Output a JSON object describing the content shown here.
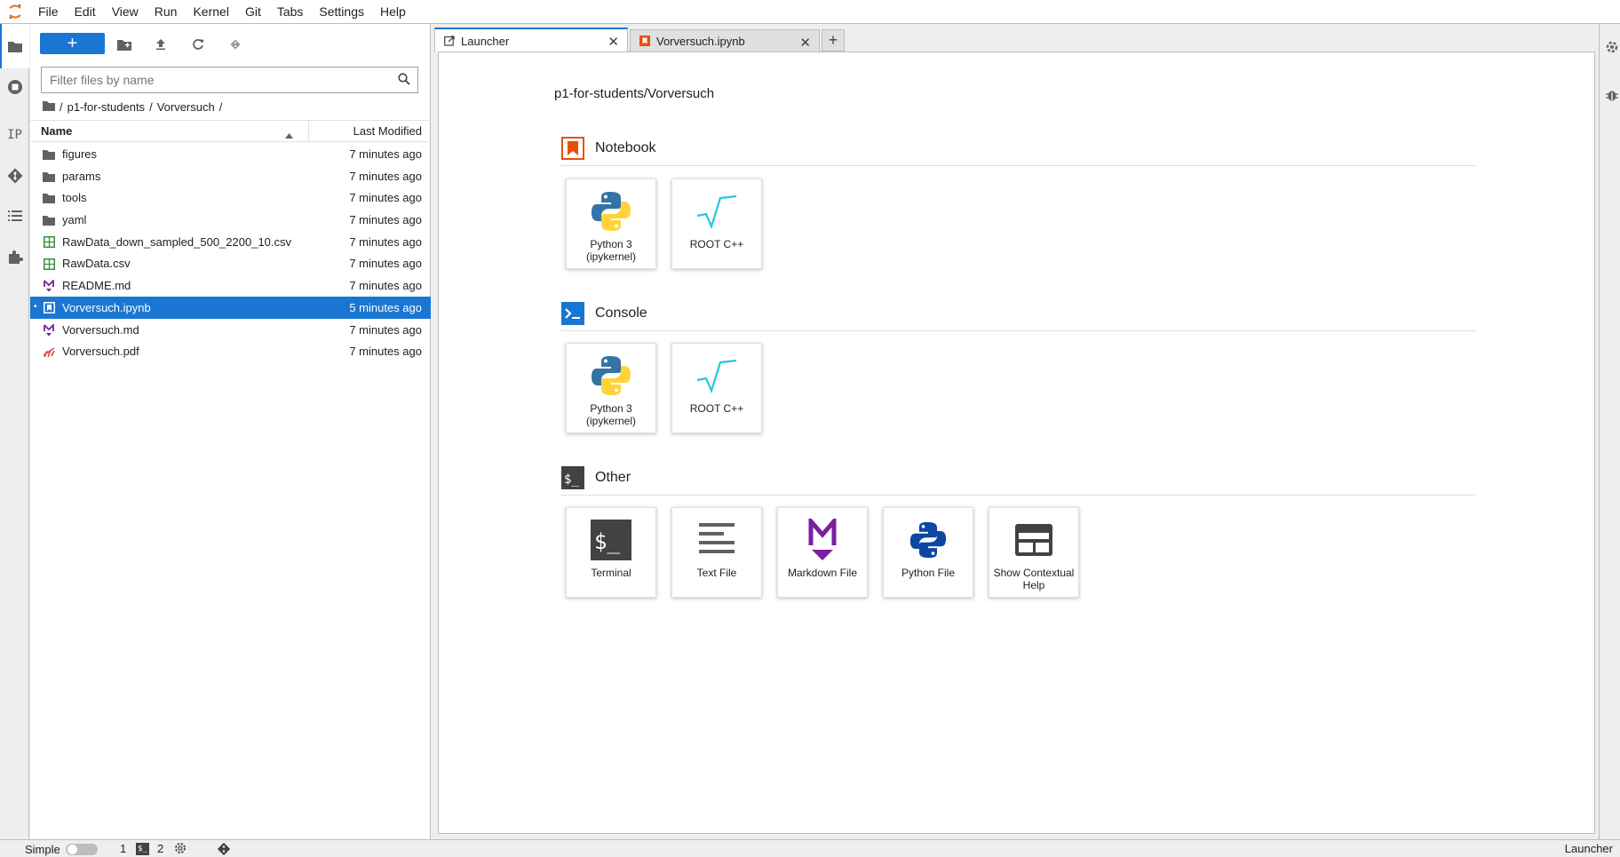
{
  "menubar": {
    "items": [
      "File",
      "Edit",
      "View",
      "Run",
      "Kernel",
      "Git",
      "Tabs",
      "Settings",
      "Help"
    ]
  },
  "leftbar": {
    "icons": [
      "folder-icon",
      "running-icon",
      "property-inspector-icon",
      "git-icon",
      "table-of-contents-icon",
      "extension-icon"
    ],
    "ip_label": "IP"
  },
  "filebrowser": {
    "new_button_label": "+",
    "search_placeholder": "Filter files by name",
    "breadcrumb": [
      "/",
      "p1-for-students",
      "/",
      "Vorversuch",
      "/"
    ],
    "columns": {
      "name": "Name",
      "modified": "Last Modified"
    },
    "files": [
      {
        "name": "figures",
        "modified": "7 minutes ago",
        "type": "folder"
      },
      {
        "name": "params",
        "modified": "7 minutes ago",
        "type": "folder"
      },
      {
        "name": "tools",
        "modified": "7 minutes ago",
        "type": "folder"
      },
      {
        "name": "yaml",
        "modified": "7 minutes ago",
        "type": "folder"
      },
      {
        "name": "RawData_down_sampled_500_2200_10.csv",
        "modified": "7 minutes ago",
        "type": "csv"
      },
      {
        "name": "RawData.csv",
        "modified": "7 minutes ago",
        "type": "csv"
      },
      {
        "name": "README.md",
        "modified": "7 minutes ago",
        "type": "markdown"
      },
      {
        "name": "Vorversuch.ipynb",
        "modified": "5 minutes ago",
        "type": "notebook",
        "selected": true,
        "marker": "•"
      },
      {
        "name": "Vorversuch.md",
        "modified": "7 minutes ago",
        "type": "markdown"
      },
      {
        "name": "Vorversuch.pdf",
        "modified": "7 minutes ago",
        "type": "pdf"
      }
    ]
  },
  "tabs": [
    {
      "label": "Launcher",
      "active": true,
      "icon": "launcher-icon"
    },
    {
      "label": "Vorversuch.ipynb",
      "active": false,
      "icon": "notebook-icon"
    }
  ],
  "launcher": {
    "cwd": "p1-for-students/Vorversuch",
    "sections": {
      "notebook": {
        "title": "Notebook",
        "cards": [
          {
            "label": "Python 3 (ipykernel)",
            "icon": "python-icon"
          },
          {
            "label": "ROOT C++",
            "icon": "root-icon"
          }
        ]
      },
      "console": {
        "title": "Console",
        "cards": [
          {
            "label": "Python 3 (ipykernel)",
            "icon": "python-icon"
          },
          {
            "label": "ROOT C++",
            "icon": "root-icon"
          }
        ]
      },
      "other": {
        "title": "Other",
        "cards": [
          {
            "label": "Terminal",
            "icon": "terminal-icon"
          },
          {
            "label": "Text File",
            "icon": "text-file-icon"
          },
          {
            "label": "Markdown File",
            "icon": "markdown-icon"
          },
          {
            "label": "Python File",
            "icon": "python-file-icon"
          },
          {
            "label": "Show Contextual Help",
            "icon": "contextual-help-icon"
          }
        ]
      }
    }
  },
  "statusbar": {
    "simple_label": "Simple",
    "terminals_count": "1",
    "kernels_count": "2",
    "right_label": "Launcher"
  },
  "colors": {
    "accent": "#1976d2",
    "notebook_orange": "#e65100",
    "markdown_purple": "#7b1fa2",
    "csv_green": "#388e3c",
    "pdf_red": "#d32f2f",
    "root_cyan": "#26c6da"
  }
}
